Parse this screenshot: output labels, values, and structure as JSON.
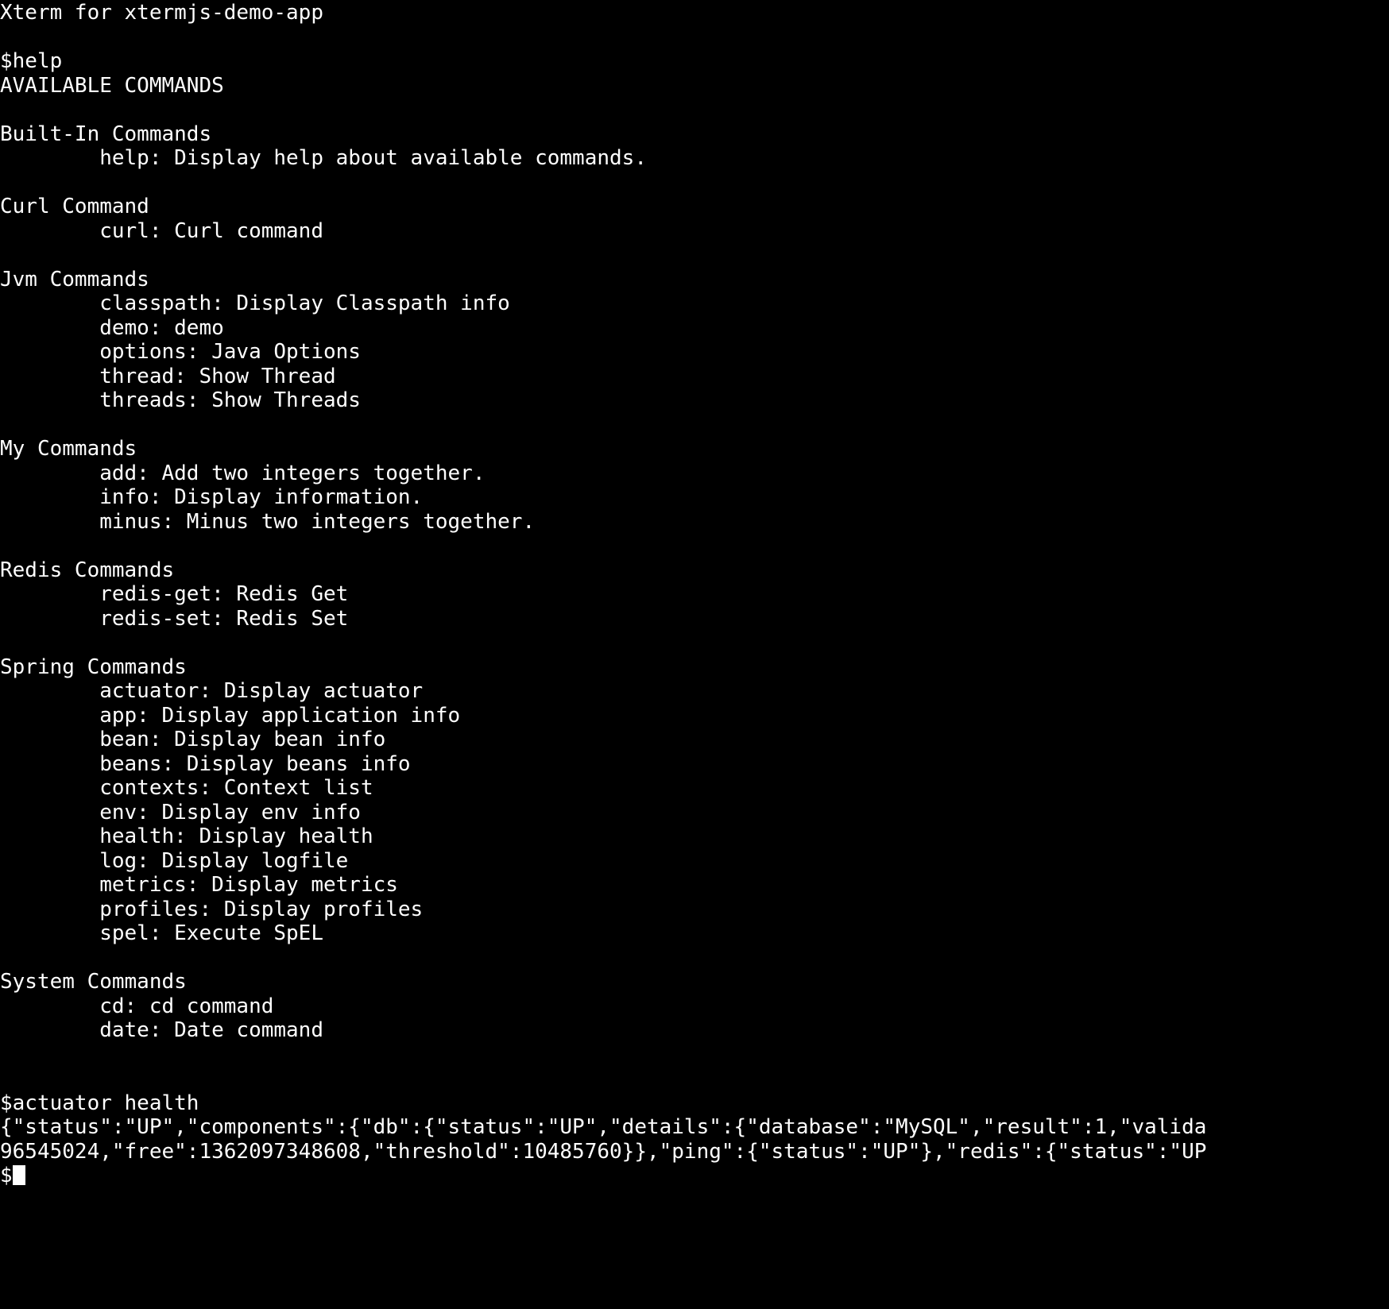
{
  "terminal": {
    "title": "Xterm for xtermjs-demo-app",
    "colors": {
      "background": "#000000",
      "foreground": "#ffffff",
      "cursor": "#ffffff"
    },
    "prompt_symbol": "$",
    "cursor": "block",
    "lines": [
      "Xterm for xtermjs-demo-app",
      "",
      "$help",
      "AVAILABLE COMMANDS",
      "",
      "Built-In Commands",
      "        help: Display help about available commands.",
      "",
      "Curl Command",
      "        curl: Curl command",
      "",
      "Jvm Commands",
      "        classpath: Display Classpath info",
      "        demo: demo",
      "        options: Java Options",
      "        thread: Show Thread",
      "        threads: Show Threads",
      "",
      "My Commands",
      "        add: Add two integers together.",
      "        info: Display information.",
      "        minus: Minus two integers together.",
      "",
      "Redis Commands",
      "        redis-get: Redis Get",
      "        redis-set: Redis Set",
      "",
      "Spring Commands",
      "        actuator: Display actuator",
      "        app: Display application info",
      "        bean: Display bean info",
      "        beans: Display beans info",
      "        contexts: Context list",
      "        env: Display env info",
      "        health: Display health",
      "        log: Display logfile",
      "        metrics: Display metrics",
      "        profiles: Display profiles",
      "        spel: Execute SpEL",
      "",
      "System Commands",
      "        cd: cd command",
      "        date: Date command",
      "",
      "",
      "$actuator health",
      "{\"status\":\"UP\",\"components\":{\"db\":{\"status\":\"UP\",\"details\":{\"database\":\"MySQL\",\"result\":1,\"valida",
      "96545024,\"free\":1362097348608,\"threshold\":10485760}},\"ping\":{\"status\":\"UP\"},\"redis\":{\"status\":\"UP"
    ],
    "sections": [
      {
        "heading": "Built-In Commands",
        "commands": [
          {
            "name": "help",
            "description": "Display help about available commands."
          }
        ]
      },
      {
        "heading": "Curl Command",
        "commands": [
          {
            "name": "curl",
            "description": "Curl command"
          }
        ]
      },
      {
        "heading": "Jvm Commands",
        "commands": [
          {
            "name": "classpath",
            "description": "Display Classpath info"
          },
          {
            "name": "demo",
            "description": "demo"
          },
          {
            "name": "options",
            "description": "Java Options"
          },
          {
            "name": "thread",
            "description": "Show Thread"
          },
          {
            "name": "threads",
            "description": "Show Threads"
          }
        ]
      },
      {
        "heading": "My Commands",
        "commands": [
          {
            "name": "add",
            "description": "Add two integers together."
          },
          {
            "name": "info",
            "description": "Display information."
          },
          {
            "name": "minus",
            "description": "Minus two integers together."
          }
        ]
      },
      {
        "heading": "Redis Commands",
        "commands": [
          {
            "name": "redis-get",
            "description": "Redis Get"
          },
          {
            "name": "redis-set",
            "description": "Redis Set"
          }
        ]
      },
      {
        "heading": "Spring Commands",
        "commands": [
          {
            "name": "actuator",
            "description": "Display actuator"
          },
          {
            "name": "app",
            "description": "Display application info"
          },
          {
            "name": "bean",
            "description": "Display bean info"
          },
          {
            "name": "beans",
            "description": "Display beans info"
          },
          {
            "name": "contexts",
            "description": "Context list"
          },
          {
            "name": "env",
            "description": "Display env info"
          },
          {
            "name": "health",
            "description": "Display health"
          },
          {
            "name": "log",
            "description": "Display logfile"
          },
          {
            "name": "metrics",
            "description": "Display metrics"
          },
          {
            "name": "profiles",
            "description": "Display profiles"
          },
          {
            "name": "spel",
            "description": "Execute SpEL"
          }
        ]
      },
      {
        "heading": "System Commands",
        "commands": [
          {
            "name": "cd",
            "description": "cd command"
          },
          {
            "name": "date",
            "description": "Date command"
          }
        ]
      }
    ],
    "commands_entered": [
      "help",
      "actuator health"
    ],
    "header_label": "AVAILABLE COMMANDS",
    "final_prompt": "$"
  }
}
